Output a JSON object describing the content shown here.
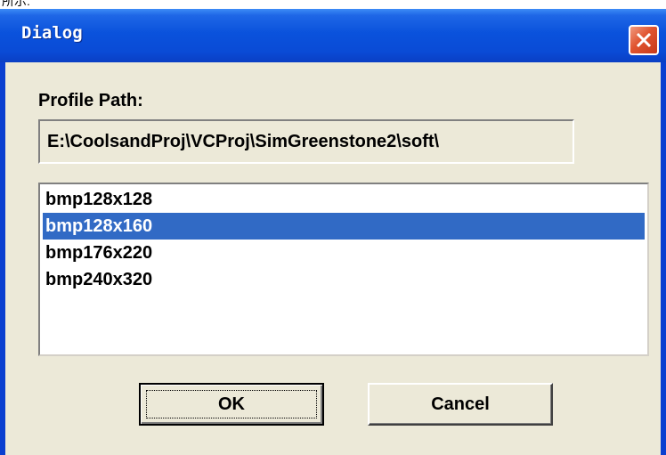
{
  "window": {
    "title": "Dialog",
    "close_icon": "close-icon"
  },
  "top_fragment": "所示:",
  "profile_path": {
    "label": "Profile Path:",
    "value": "E:\\CoolsandProj\\VCProj\\SimGreenstone2\\soft\\"
  },
  "list": {
    "items": [
      "bmp128x128",
      "bmp128x160",
      "bmp176x220",
      "bmp240x320"
    ],
    "selected_index": 1
  },
  "buttons": {
    "ok_label": "OK",
    "cancel_label": "Cancel"
  },
  "colors": {
    "selection": "#316ac5",
    "titlebar": "#0a52dc",
    "dialog_face": "#ece9d8",
    "close_button": "#e0542f"
  }
}
